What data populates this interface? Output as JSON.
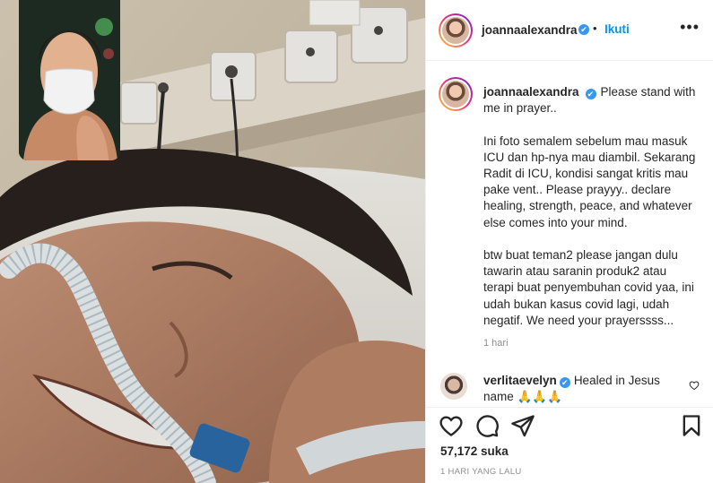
{
  "post": {
    "author": "joannaalexandra",
    "follow_label": "Ikuti",
    "more_label": "•••",
    "verified_glyph": "✔",
    "header_separator": "•"
  },
  "caption": {
    "author": "joannaalexandra",
    "text": "Please stand with me in prayer..\n\nIni foto semalem sebelum mau masuk ICU dan hp-nya mau diambil. Sekarang Radit di ICU, kondisi sangat kritis mau pake vent.. Please prayyy.. declare healing, strength, peace, and whatever else comes into your mind.\n\nbtw buat teman2 please jangan dulu tawarin atau saranin produk2 atau terapi buat penyembuhan covid yaa, ini udah bukan kasus covid lagi, udah negatif. We need your prayerssss...",
    "time": "1 hari"
  },
  "comment": {
    "author": "verlitaevelyn",
    "text": "Healed in Jesus name 🙏🙏🙏",
    "like_icon": "heart-outline-icon"
  },
  "engagement": {
    "likes": "57,172 suka",
    "date": "1 HARI YANG LALU"
  },
  "icons": {
    "like": "heart-icon",
    "comment": "comment-bubble-icon",
    "share": "paper-plane-icon",
    "save": "bookmark-icon"
  },
  "colors": {
    "link_blue": "#0095f6",
    "verified_blue": "#3897f0",
    "muted_gray": "#8e8e8e",
    "text": "#262626"
  }
}
